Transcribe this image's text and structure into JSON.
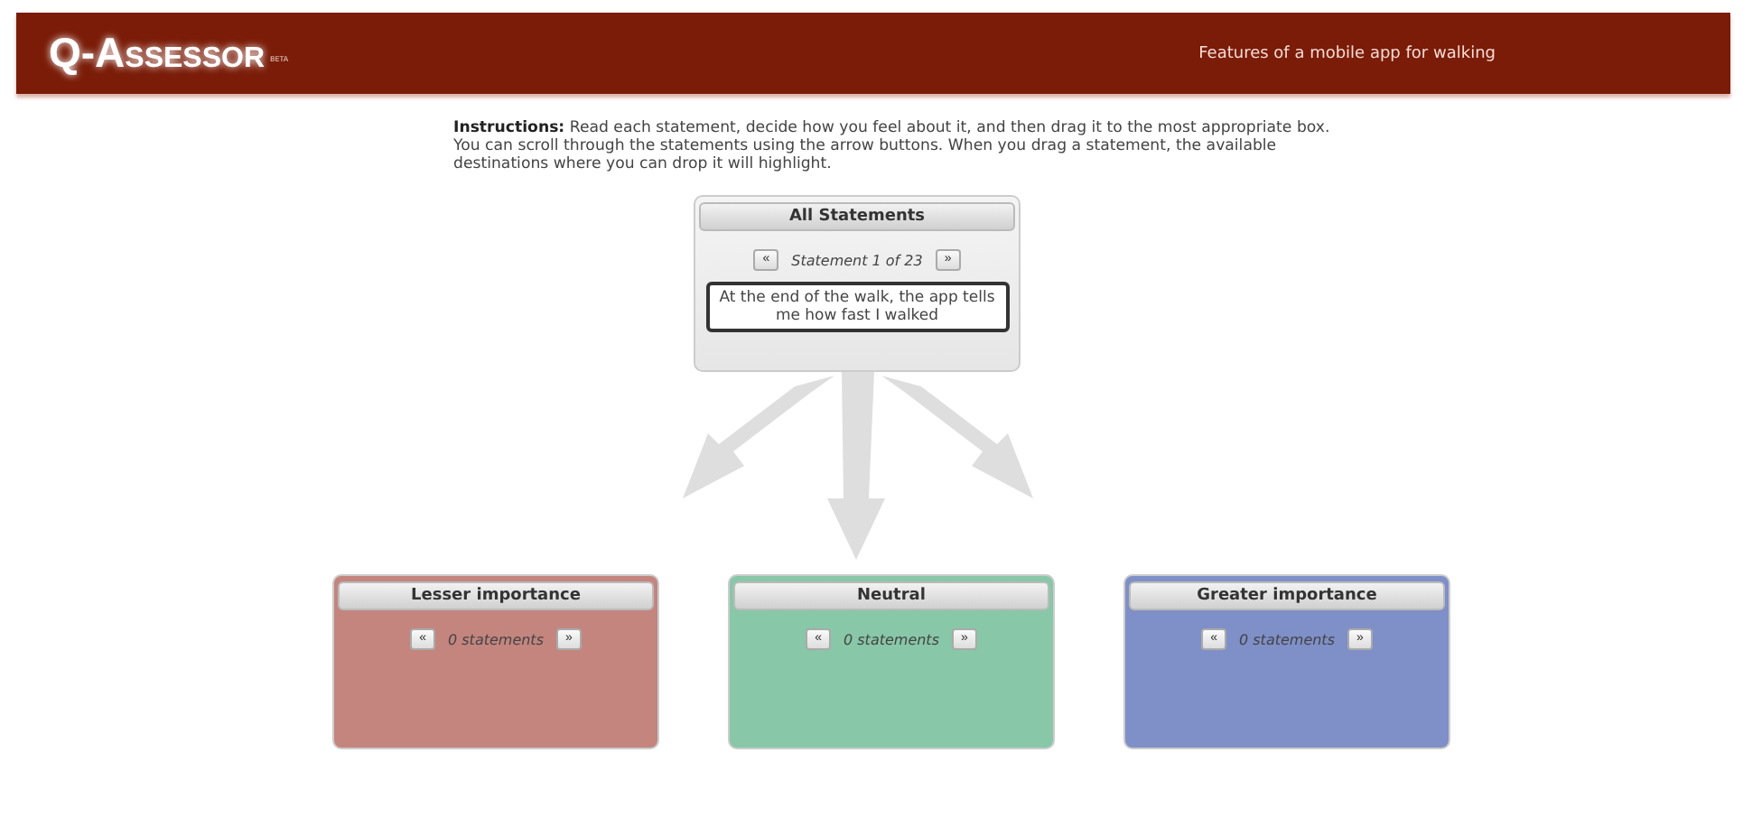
{
  "header": {
    "logo": "Q-Assessor",
    "badge": "BETA",
    "title": "Features of a mobile app for walking"
  },
  "instructions": "**Instructions:** Read each statement, decide how you feel about it, and then drag it to the most appropriate box. You can scroll through the statements using the arrow buttons. When you drag a statement, the available destinations where you can drop it will highlight.",
  "source": {
    "title": "All Statements",
    "prev": "«",
    "next": "»",
    "counter": "Statement 1 of 23",
    "statement": "At the end of the walk, the app tells me how fast I walked"
  },
  "bins": [
    {
      "title": "Lesser importance",
      "color": "#c4857f",
      "prev": "«",
      "next": "»",
      "counter": "0 statements"
    },
    {
      "title": "Neutral",
      "color": "#88c7a8",
      "prev": "«",
      "next": "»",
      "counter": "0 statements"
    },
    {
      "title": "Greater importance",
      "color": "#7f8fc8",
      "prev": "«",
      "next": "»",
      "counter": "0 statements"
    }
  ]
}
